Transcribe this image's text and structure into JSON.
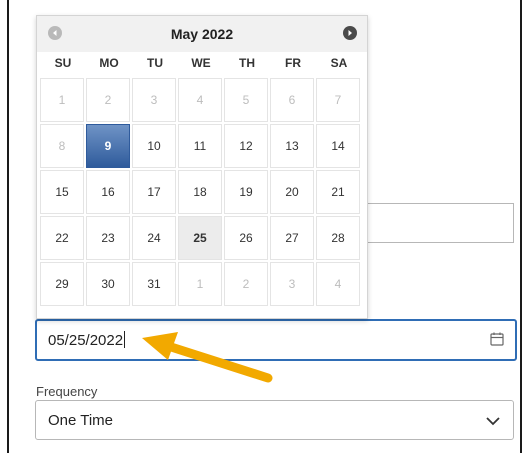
{
  "calendar": {
    "month_label": "May 2022",
    "weekdays": [
      "SU",
      "MO",
      "TU",
      "WE",
      "TH",
      "FR",
      "SA"
    ],
    "days": [
      {
        "label": "1",
        "state": "disabled"
      },
      {
        "label": "2",
        "state": "disabled"
      },
      {
        "label": "3",
        "state": "disabled"
      },
      {
        "label": "4",
        "state": "disabled"
      },
      {
        "label": "5",
        "state": "disabled"
      },
      {
        "label": "6",
        "state": "disabled"
      },
      {
        "label": "7",
        "state": "disabled"
      },
      {
        "label": "8",
        "state": "disabled"
      },
      {
        "label": "9",
        "state": "selected"
      },
      {
        "label": "10",
        "state": "normal"
      },
      {
        "label": "11",
        "state": "normal"
      },
      {
        "label": "12",
        "state": "normal"
      },
      {
        "label": "13",
        "state": "normal"
      },
      {
        "label": "14",
        "state": "normal"
      },
      {
        "label": "15",
        "state": "normal"
      },
      {
        "label": "16",
        "state": "normal"
      },
      {
        "label": "17",
        "state": "normal"
      },
      {
        "label": "18",
        "state": "normal"
      },
      {
        "label": "19",
        "state": "normal"
      },
      {
        "label": "20",
        "state": "normal"
      },
      {
        "label": "21",
        "state": "normal"
      },
      {
        "label": "22",
        "state": "normal"
      },
      {
        "label": "23",
        "state": "normal"
      },
      {
        "label": "24",
        "state": "normal"
      },
      {
        "label": "25",
        "state": "today"
      },
      {
        "label": "26",
        "state": "normal"
      },
      {
        "label": "27",
        "state": "normal"
      },
      {
        "label": "28",
        "state": "normal"
      },
      {
        "label": "29",
        "state": "normal"
      },
      {
        "label": "30",
        "state": "normal"
      },
      {
        "label": "31",
        "state": "normal"
      },
      {
        "label": "1",
        "state": "other-month"
      },
      {
        "label": "2",
        "state": "other-month"
      },
      {
        "label": "3",
        "state": "other-month"
      },
      {
        "label": "4",
        "state": "other-month"
      }
    ],
    "prev_icon": "chevron-left-icon",
    "next_icon": "chevron-right-icon"
  },
  "date_field": {
    "value": "05/25/2022",
    "icon": "calendar-icon"
  },
  "frequency": {
    "label": "Frequency",
    "value": "One Time",
    "icon": "chevron-down-icon"
  },
  "annotation": {
    "icon": "arrow-pointer-icon",
    "color": "#f2a900"
  },
  "colors": {
    "accent": "#2f6db5",
    "selected_day": "#3d66a6"
  }
}
